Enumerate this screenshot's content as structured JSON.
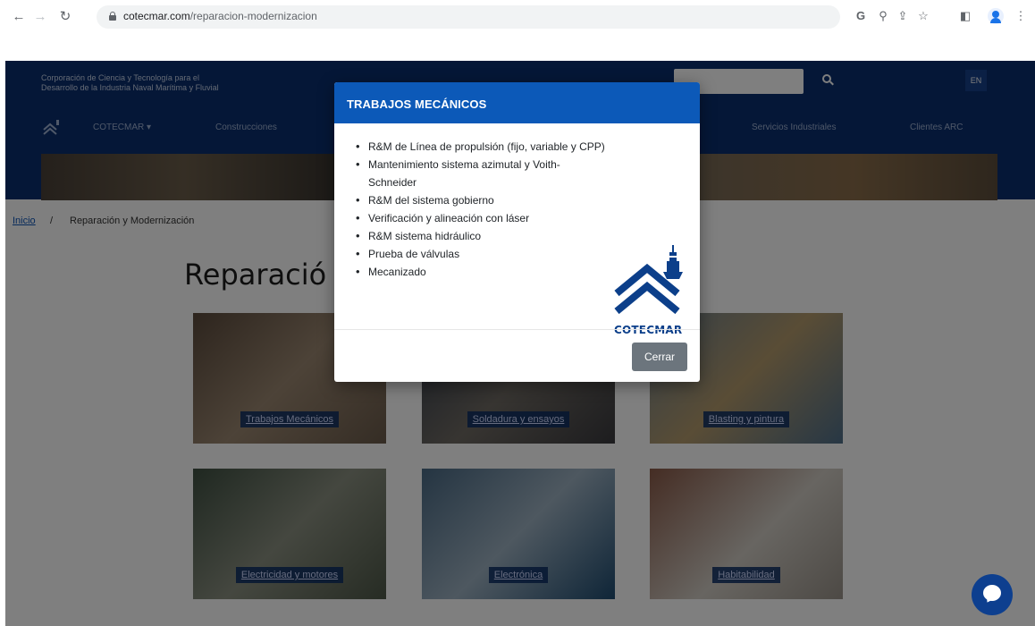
{
  "browser": {
    "url_host": "cotecmar.com",
    "url_path": "/reparacion-modernizacion",
    "back_icon": "arrow-left-icon",
    "forward_icon": "arrow-right-icon",
    "reload_icon": "reload-icon"
  },
  "site": {
    "corp_line1": "Corporación de Ciencia y Tecnología para el",
    "corp_line2": "Desarrollo de la Industria Naval Marítima y Fluvial",
    "lang_button": "EN",
    "menu": [
      "COTECMAR ▾",
      "Construcciones",
      "Servicios Industriales",
      "Clientes ARC"
    ],
    "breadcrumb_home": "Inicio",
    "breadcrumb_sep": "/",
    "breadcrumb_current": "Reparación y Modernización",
    "page_title": "Reparació",
    "cards": [
      {
        "caption": "Trabajos Mecánicos"
      },
      {
        "caption": "Soldadura y ensayos"
      },
      {
        "caption": "Blasting y pintura"
      },
      {
        "caption": "Electricidad y motores"
      },
      {
        "caption": "Electrónica"
      },
      {
        "caption": "Habitabilidad"
      }
    ]
  },
  "modal": {
    "title": "TRABAJOS MECÁNICOS",
    "items": [
      "R&M de Línea de propulsión (fijo, variable y CPP)",
      "Mantenimiento sistema azimutal y Voith-Schneider",
      "R&M del sistema gobierno",
      "Verificación y alineación con láser",
      "R&M sistema hidráulico",
      "Prueba de válvulas",
      "Mecanizado"
    ],
    "logo_text": "COTECMAR",
    "close_label": "Cerrar"
  },
  "colors": {
    "brand_blue": "#0c59b8",
    "navy": "#0a2f6e",
    "button_gray": "#6c757d"
  }
}
